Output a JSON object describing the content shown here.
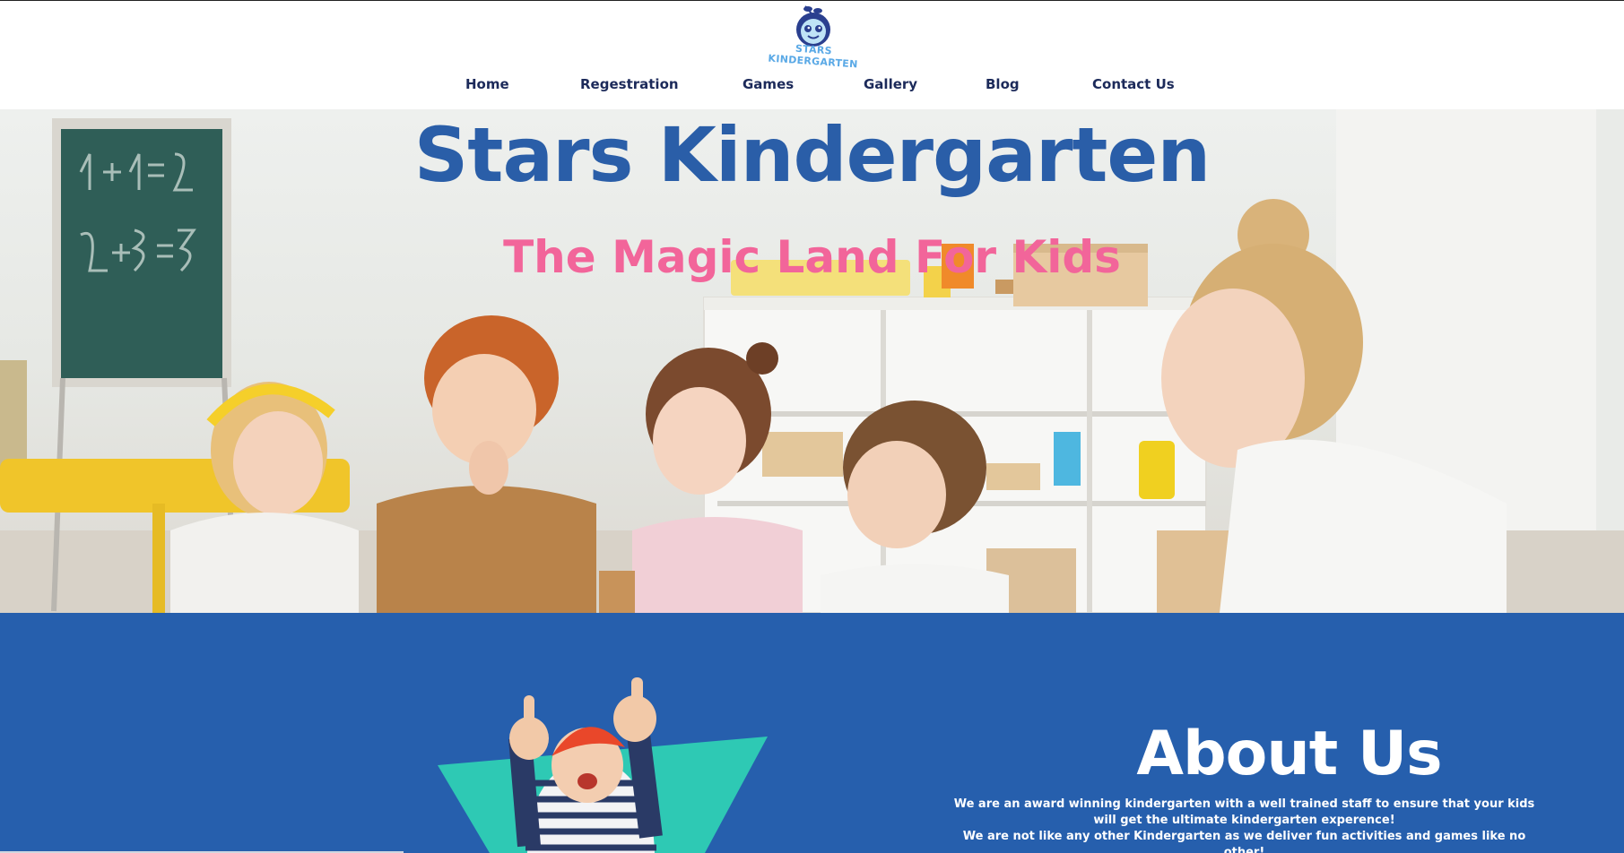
{
  "brand": {
    "name": "Stars Kindergarten",
    "logo_text": "STARS KINDERGARTEN"
  },
  "nav": [
    {
      "label": "Home"
    },
    {
      "label": "Regestration"
    },
    {
      "label": "Games"
    },
    {
      "label": "Gallery"
    },
    {
      "label": "Blog"
    },
    {
      "label": "Contact Us"
    }
  ],
  "hero": {
    "title": "Stars Kindergarten",
    "subtitle": "The Magic Land For Kids"
  },
  "about": {
    "title": "About Us",
    "paragraphs": [
      "We are an award winning kindergarten with a well trained staff to ensure that your kids will get the ultimate kindergarten experence!",
      "We are not like any other Kindergarten as we deliver fun activities and games like no other!"
    ]
  },
  "colors": {
    "brand_blue": "#2a5ea8",
    "about_bg": "#265fad",
    "accent_pink": "#f2659a",
    "nav_text": "#1c2a5a",
    "teal": "#2ec9b4"
  }
}
